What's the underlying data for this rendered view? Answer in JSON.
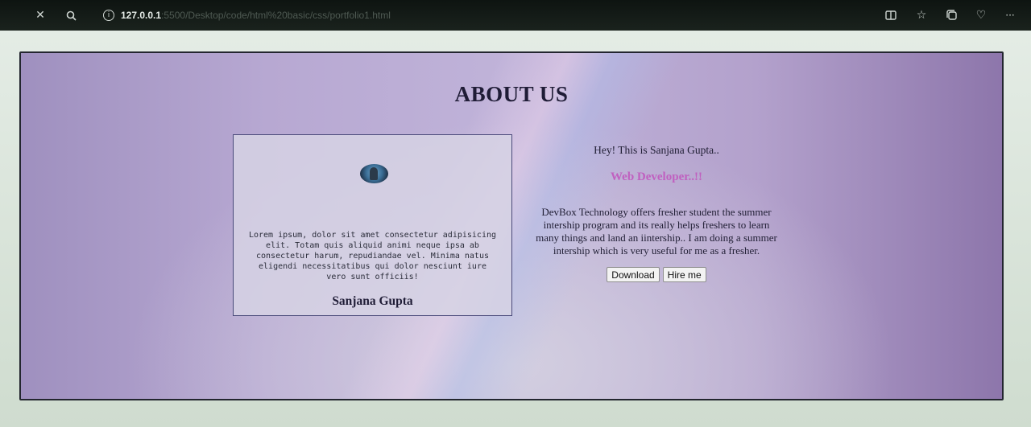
{
  "browser": {
    "url_host": "127.0.0.1",
    "url_path": ":5500/Desktop/code/html%20basic/css/portfolio1.html"
  },
  "icons": {
    "close": "close-icon",
    "search": "search-icon",
    "info": "info-icon",
    "reader": "reader-mode-icon",
    "favorites": "favorites-icon",
    "collections": "collections-icon",
    "heart": "heart-icon",
    "more": "more-icon"
  },
  "colors": {
    "role_accent": "#c060c0",
    "hero_border": "#23262f"
  },
  "page": {
    "title": "ABOUT US",
    "card": {
      "text": "Lorem ipsum, dolor sit amet consectetur adipisicing elit. Totam quis aliquid animi neque ipsa ab consectetur harum, repudiandae vel. Minima natus eligendi necessitatibus qui dolor nesciunt iure vero sunt officiis!",
      "name": "Sanjana Gupta"
    },
    "info": {
      "greeting": "Hey! This is Sanjana Gupta..",
      "role": "Web Developer..!!",
      "description": "DevBox Technology offers fresher student the summer intership program and its really helps freshers to learn many things and land an iintership.. I am doing a summer intership which is very useful for me as a fresher.",
      "download_label": "Download",
      "hire_label": "Hire me"
    }
  }
}
